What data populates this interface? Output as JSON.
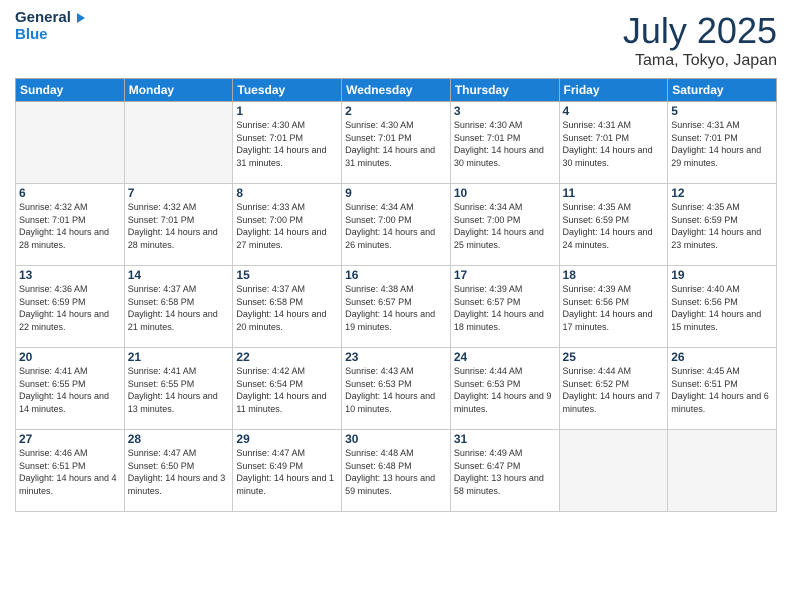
{
  "header": {
    "logo_line1": "General",
    "logo_line2": "Blue",
    "month_year": "July 2025",
    "location": "Tama, Tokyo, Japan"
  },
  "weekdays": [
    "Sunday",
    "Monday",
    "Tuesday",
    "Wednesday",
    "Thursday",
    "Friday",
    "Saturday"
  ],
  "weeks": [
    [
      {
        "day": "",
        "sunrise": "",
        "sunset": "",
        "daylight": ""
      },
      {
        "day": "",
        "sunrise": "",
        "sunset": "",
        "daylight": ""
      },
      {
        "day": "1",
        "sunrise": "Sunrise: 4:30 AM",
        "sunset": "Sunset: 7:01 PM",
        "daylight": "Daylight: 14 hours and 31 minutes."
      },
      {
        "day": "2",
        "sunrise": "Sunrise: 4:30 AM",
        "sunset": "Sunset: 7:01 PM",
        "daylight": "Daylight: 14 hours and 31 minutes."
      },
      {
        "day": "3",
        "sunrise": "Sunrise: 4:30 AM",
        "sunset": "Sunset: 7:01 PM",
        "daylight": "Daylight: 14 hours and 30 minutes."
      },
      {
        "day": "4",
        "sunrise": "Sunrise: 4:31 AM",
        "sunset": "Sunset: 7:01 PM",
        "daylight": "Daylight: 14 hours and 30 minutes."
      },
      {
        "day": "5",
        "sunrise": "Sunrise: 4:31 AM",
        "sunset": "Sunset: 7:01 PM",
        "daylight": "Daylight: 14 hours and 29 minutes."
      }
    ],
    [
      {
        "day": "6",
        "sunrise": "Sunrise: 4:32 AM",
        "sunset": "Sunset: 7:01 PM",
        "daylight": "Daylight: 14 hours and 28 minutes."
      },
      {
        "day": "7",
        "sunrise": "Sunrise: 4:32 AM",
        "sunset": "Sunset: 7:01 PM",
        "daylight": "Daylight: 14 hours and 28 minutes."
      },
      {
        "day": "8",
        "sunrise": "Sunrise: 4:33 AM",
        "sunset": "Sunset: 7:00 PM",
        "daylight": "Daylight: 14 hours and 27 minutes."
      },
      {
        "day": "9",
        "sunrise": "Sunrise: 4:34 AM",
        "sunset": "Sunset: 7:00 PM",
        "daylight": "Daylight: 14 hours and 26 minutes."
      },
      {
        "day": "10",
        "sunrise": "Sunrise: 4:34 AM",
        "sunset": "Sunset: 7:00 PM",
        "daylight": "Daylight: 14 hours and 25 minutes."
      },
      {
        "day": "11",
        "sunrise": "Sunrise: 4:35 AM",
        "sunset": "Sunset: 6:59 PM",
        "daylight": "Daylight: 14 hours and 24 minutes."
      },
      {
        "day": "12",
        "sunrise": "Sunrise: 4:35 AM",
        "sunset": "Sunset: 6:59 PM",
        "daylight": "Daylight: 14 hours and 23 minutes."
      }
    ],
    [
      {
        "day": "13",
        "sunrise": "Sunrise: 4:36 AM",
        "sunset": "Sunset: 6:59 PM",
        "daylight": "Daylight: 14 hours and 22 minutes."
      },
      {
        "day": "14",
        "sunrise": "Sunrise: 4:37 AM",
        "sunset": "Sunset: 6:58 PM",
        "daylight": "Daylight: 14 hours and 21 minutes."
      },
      {
        "day": "15",
        "sunrise": "Sunrise: 4:37 AM",
        "sunset": "Sunset: 6:58 PM",
        "daylight": "Daylight: 14 hours and 20 minutes."
      },
      {
        "day": "16",
        "sunrise": "Sunrise: 4:38 AM",
        "sunset": "Sunset: 6:57 PM",
        "daylight": "Daylight: 14 hours and 19 minutes."
      },
      {
        "day": "17",
        "sunrise": "Sunrise: 4:39 AM",
        "sunset": "Sunset: 6:57 PM",
        "daylight": "Daylight: 14 hours and 18 minutes."
      },
      {
        "day": "18",
        "sunrise": "Sunrise: 4:39 AM",
        "sunset": "Sunset: 6:56 PM",
        "daylight": "Daylight: 14 hours and 17 minutes."
      },
      {
        "day": "19",
        "sunrise": "Sunrise: 4:40 AM",
        "sunset": "Sunset: 6:56 PM",
        "daylight": "Daylight: 14 hours and 15 minutes."
      }
    ],
    [
      {
        "day": "20",
        "sunrise": "Sunrise: 4:41 AM",
        "sunset": "Sunset: 6:55 PM",
        "daylight": "Daylight: 14 hours and 14 minutes."
      },
      {
        "day": "21",
        "sunrise": "Sunrise: 4:41 AM",
        "sunset": "Sunset: 6:55 PM",
        "daylight": "Daylight: 14 hours and 13 minutes."
      },
      {
        "day": "22",
        "sunrise": "Sunrise: 4:42 AM",
        "sunset": "Sunset: 6:54 PM",
        "daylight": "Daylight: 14 hours and 11 minutes."
      },
      {
        "day": "23",
        "sunrise": "Sunrise: 4:43 AM",
        "sunset": "Sunset: 6:53 PM",
        "daylight": "Daylight: 14 hours and 10 minutes."
      },
      {
        "day": "24",
        "sunrise": "Sunrise: 4:44 AM",
        "sunset": "Sunset: 6:53 PM",
        "daylight": "Daylight: 14 hours and 9 minutes."
      },
      {
        "day": "25",
        "sunrise": "Sunrise: 4:44 AM",
        "sunset": "Sunset: 6:52 PM",
        "daylight": "Daylight: 14 hours and 7 minutes."
      },
      {
        "day": "26",
        "sunrise": "Sunrise: 4:45 AM",
        "sunset": "Sunset: 6:51 PM",
        "daylight": "Daylight: 14 hours and 6 minutes."
      }
    ],
    [
      {
        "day": "27",
        "sunrise": "Sunrise: 4:46 AM",
        "sunset": "Sunset: 6:51 PM",
        "daylight": "Daylight: 14 hours and 4 minutes."
      },
      {
        "day": "28",
        "sunrise": "Sunrise: 4:47 AM",
        "sunset": "Sunset: 6:50 PM",
        "daylight": "Daylight: 14 hours and 3 minutes."
      },
      {
        "day": "29",
        "sunrise": "Sunrise: 4:47 AM",
        "sunset": "Sunset: 6:49 PM",
        "daylight": "Daylight: 14 hours and 1 minute."
      },
      {
        "day": "30",
        "sunrise": "Sunrise: 4:48 AM",
        "sunset": "Sunset: 6:48 PM",
        "daylight": "Daylight: 13 hours and 59 minutes."
      },
      {
        "day": "31",
        "sunrise": "Sunrise: 4:49 AM",
        "sunset": "Sunset: 6:47 PM",
        "daylight": "Daylight: 13 hours and 58 minutes."
      },
      {
        "day": "",
        "sunrise": "",
        "sunset": "",
        "daylight": ""
      },
      {
        "day": "",
        "sunrise": "",
        "sunset": "",
        "daylight": ""
      }
    ]
  ]
}
